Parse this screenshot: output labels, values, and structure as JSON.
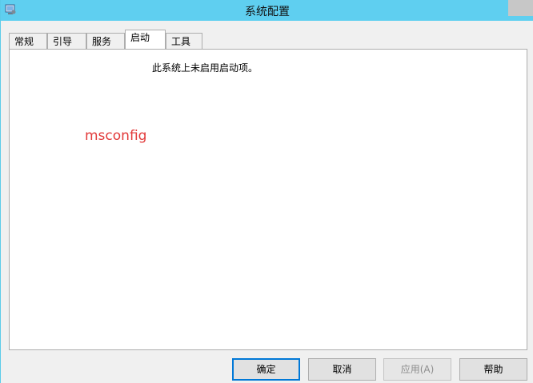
{
  "window": {
    "title": "系统配置"
  },
  "tabs": [
    {
      "label": "常规"
    },
    {
      "label": "引导"
    },
    {
      "label": "服务"
    },
    {
      "label": "启动",
      "active": true
    },
    {
      "label": "工具"
    }
  ],
  "startup_panel": {
    "message": "此系统上未启用启动项。",
    "annotation": "msconfig",
    "annotation_color": "#e23a3a"
  },
  "buttons": {
    "ok": "确定",
    "cancel": "取消",
    "apply": "应用(A)",
    "help": "帮助"
  },
  "colors": {
    "titlebar": "#5fcff0",
    "default_button_border": "#0078d7"
  }
}
